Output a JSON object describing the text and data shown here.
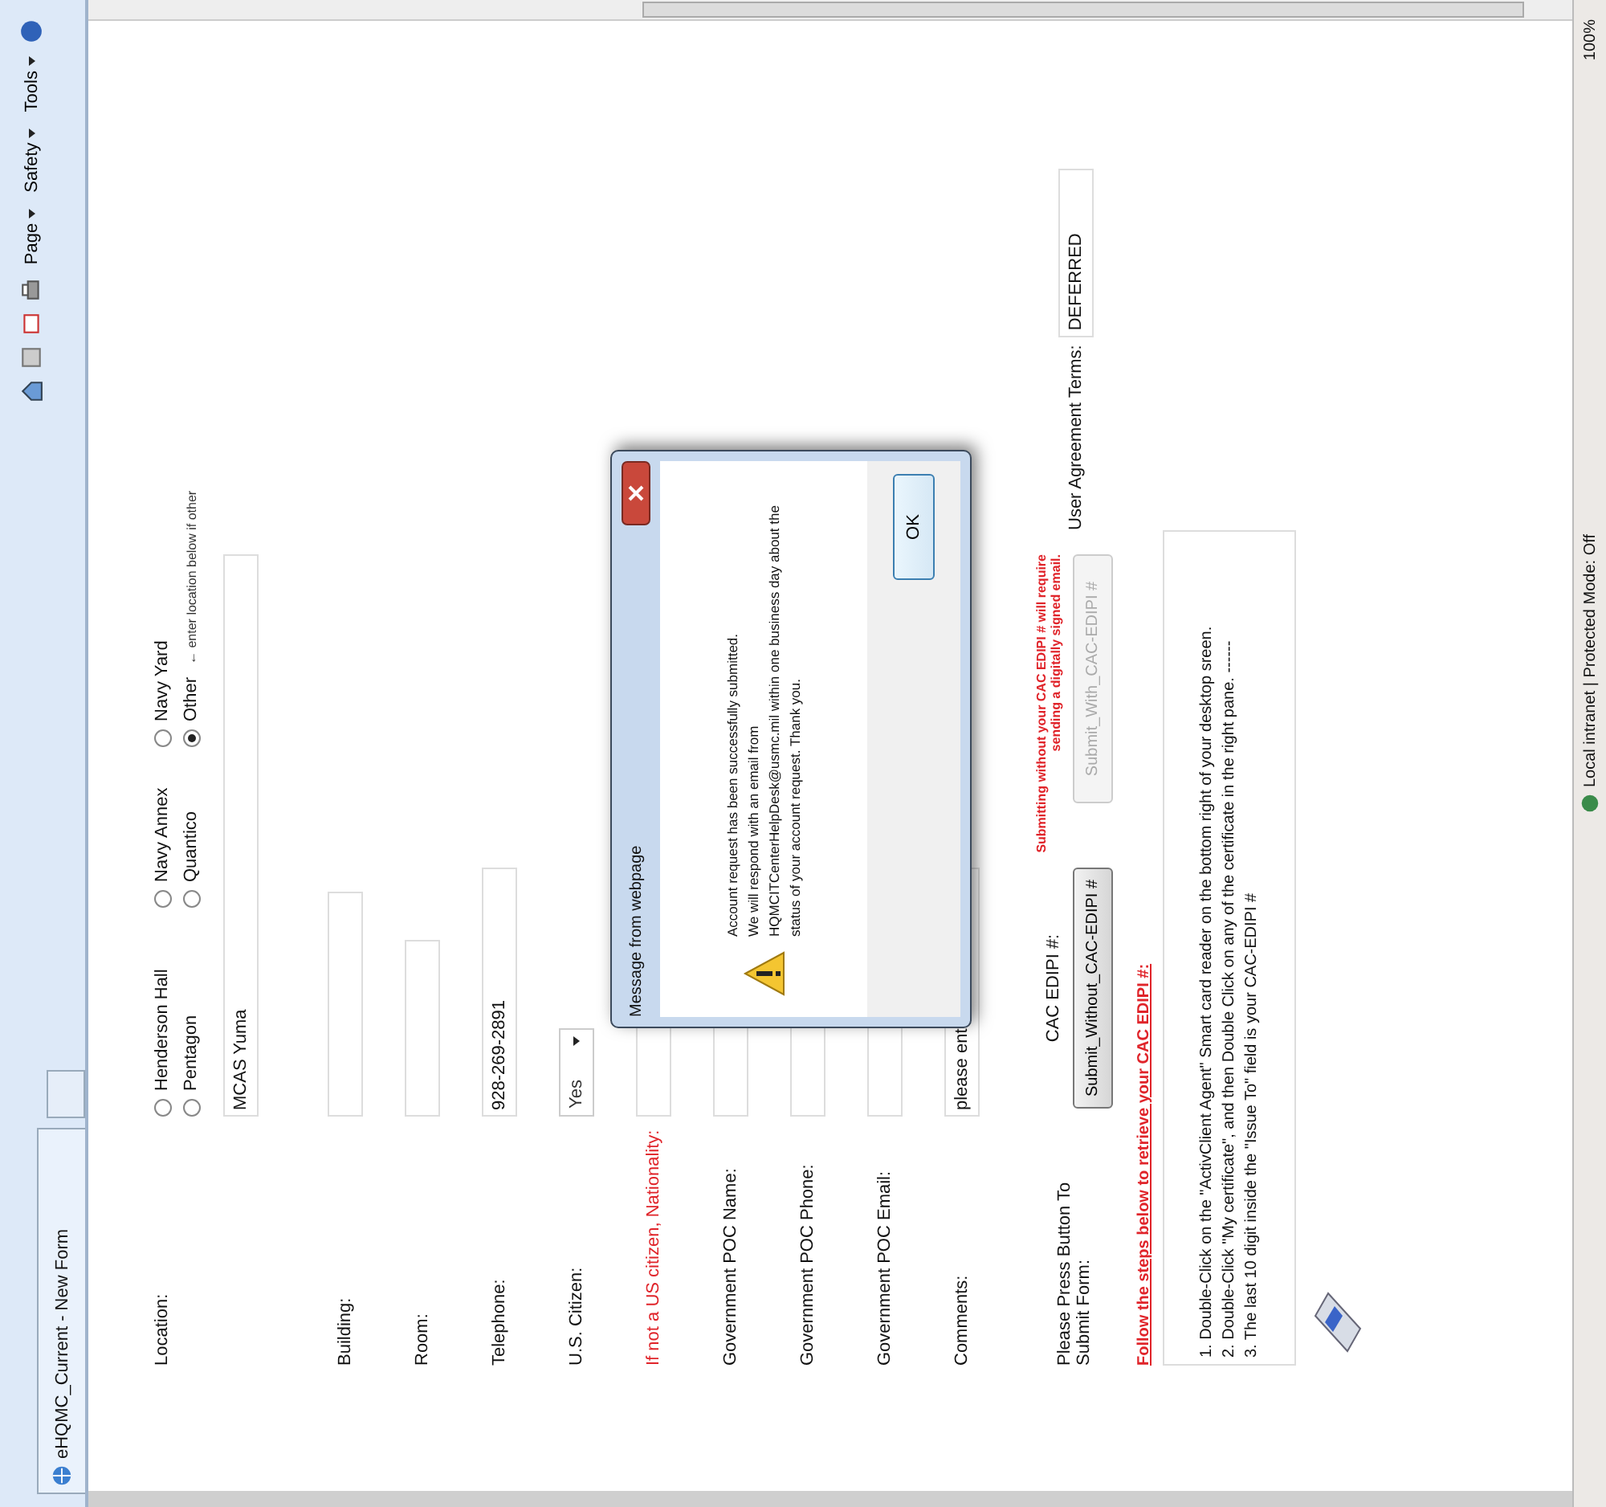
{
  "browser": {
    "tab_title": "eHQMC_Current - New Form",
    "menus": [
      "Page",
      "Safety",
      "Tools"
    ]
  },
  "form": {
    "location": {
      "label": "Location:",
      "options": [
        {
          "label": "Henderson Hall",
          "selected": false
        },
        {
          "label": "Navy Annex",
          "selected": false
        },
        {
          "label": "Navy Yard",
          "selected": false
        },
        {
          "label": "Pentagon",
          "selected": false
        },
        {
          "label": "Quantico",
          "selected": false
        },
        {
          "label": "Other",
          "selected": true
        }
      ],
      "other_hint": "← enter location below if other",
      "value": "MCAS Yuma"
    },
    "fields": [
      {
        "label": "Building:",
        "kind": "text",
        "highlight": false
      },
      {
        "label": "Room:",
        "kind": "text",
        "highlight": false
      },
      {
        "label": "Telephone:",
        "kind": "text",
        "value": "928-269-2891",
        "highlight": false
      },
      {
        "label": "U.S. Citizen:",
        "kind": "select",
        "value": "Yes",
        "highlight": false
      },
      {
        "label": "If not a US citizen, Nationality:",
        "kind": "text",
        "highlight": true
      },
      {
        "label": "Government POC Name:",
        "kind": "text",
        "highlight": false
      },
      {
        "label": "Government POC Phone:",
        "kind": "text",
        "highlight": false
      },
      {
        "label": "Government POC Email:",
        "kind": "text",
        "highlight": false
      },
      {
        "label": "Comments:",
        "kind": "text",
        "value": "please ent",
        "highlight": false
      }
    ],
    "submit_label": "Please Press Button To Submit Form:",
    "cac_label": "CAC EDIPI #:",
    "buttons": [
      {
        "label": "Submit_Without_CAC-EDIPI #",
        "disabled": false
      },
      {
        "label": "Submit_With_CAC-EDIPI #",
        "disabled": true
      }
    ],
    "warning_note": "Submitting without your CAC EDIPI # will require sending a digitally signed email.",
    "terms_label": "User Agreement Terms:",
    "terms_value": "DEFERRED",
    "steps_heading": "Follow the steps below to retrieve your CAC EDIPI #:",
    "steps": [
      "1. Double-Click on the \"ActivClient Agent\" Smart card reader on the bottom right of your desktop sreen.",
      "2. Double-Click \"My certificate\", and then Double Click on any of the certificate in the right pane. ------",
      "3. The last 10 digit inside the \"Issue To\" field is your CAC-EDIPI #"
    ]
  },
  "dialog": {
    "title": "Message from webpage",
    "lines": [
      "Account request has been successfully submitted.",
      "We will respond with an email from",
      "HQMCITCenterHelpDesk@usmc.mil within one business day about the",
      "status of your account request. Thank you."
    ],
    "button": "OK"
  },
  "status_bar": {
    "zone": "Local intranet | Protected Mode: Off",
    "zoom": "100%"
  }
}
